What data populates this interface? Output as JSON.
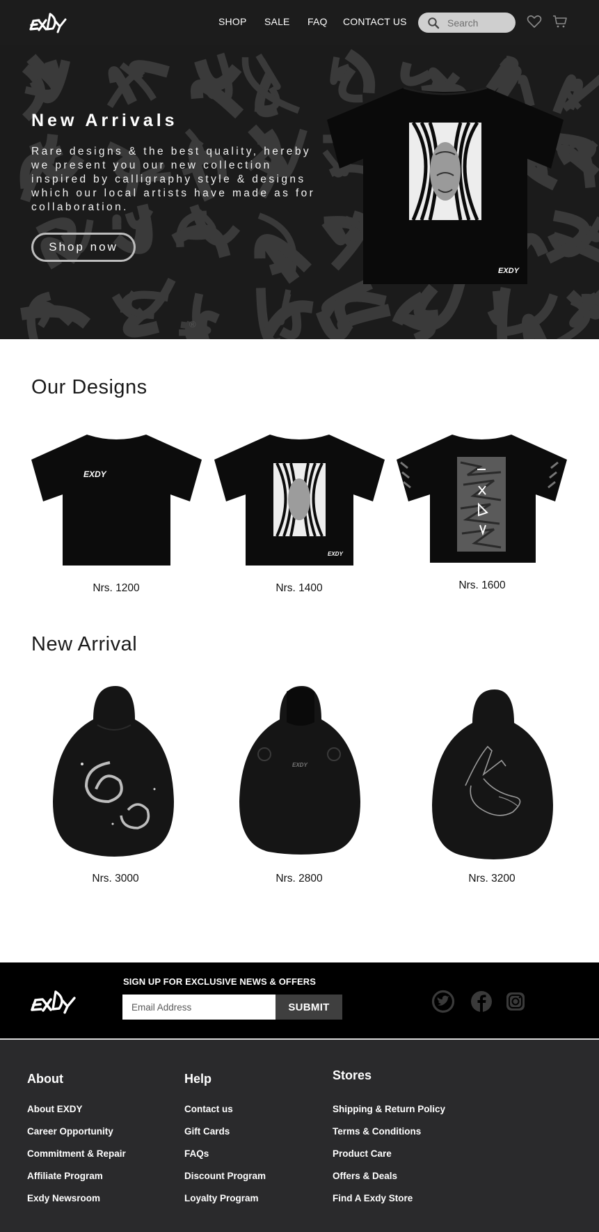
{
  "nav": {
    "logo_text": "EXDY",
    "links": [
      "SHOP",
      "SALE",
      "FAQ",
      "CONTACT US"
    ],
    "search_placeholder": "Search",
    "icons": [
      "search-icon",
      "heart-icon",
      "cart-icon"
    ]
  },
  "hero": {
    "title": "New Arrivals",
    "text": "Rare designs & the best quality, hereby we present you our new collection inspired by calligraphy style & designs which our local artists have made as for collaboration.",
    "button": "Shop now",
    "registered_mark": "®"
  },
  "designs": {
    "title": "Our Designs",
    "products": [
      {
        "price": "Nrs. 1200",
        "graphic": "small-logo-tee"
      },
      {
        "price": "Nrs. 1400",
        "graphic": "stripe-face-tee"
      },
      {
        "price": "Nrs. 1600",
        "graphic": "calligraphy-panel-tee"
      }
    ]
  },
  "arrivals": {
    "title": "New Arrival",
    "products": [
      {
        "price": "Nrs. 3000",
        "graphic": "galaxy-hoodie"
      },
      {
        "price": "Nrs. 2800",
        "graphic": "skull-floral-hoodie"
      },
      {
        "price": "Nrs. 3200",
        "graphic": "hand-sketch-hoodie"
      }
    ]
  },
  "newsletter": {
    "heading": "SIGN UP FOR EXCLUSIVE NEWS & OFFERS",
    "email_placeholder": "Email Address",
    "submit": "SUBMIT",
    "social": [
      "twitter-icon",
      "facebook-icon",
      "instagram-icon"
    ]
  },
  "footer": {
    "columns": [
      {
        "title": "About",
        "links": [
          "About EXDY",
          "Career Opportunity",
          "Commitment & Repair",
          "Affiliate Program",
          "Exdy Newsroom"
        ]
      },
      {
        "title": "Help",
        "links": [
          "Contact us",
          "Gift Cards",
          "FAQs",
          "Discount Program",
          "Loyalty Program"
        ]
      },
      {
        "title": "Stores",
        "links": [
          "Shipping & Return Policy",
          "Terms & Conditions",
          "Product Care",
          "Offers & Deals",
          "Find A Exdy Store"
        ]
      }
    ]
  },
  "colors": {
    "nav_bg": "#1c1c1c",
    "hero_bg": "#1b1b1b",
    "newsletter_bg": "#000000",
    "footer_bg": "#2a2a2c",
    "search_bg": "#cfcfcf"
  }
}
